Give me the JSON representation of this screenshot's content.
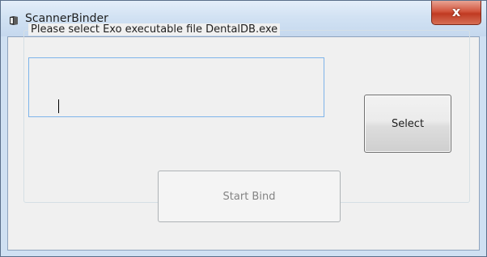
{
  "window": {
    "title": "ScannerBinder",
    "icon": "app-icon",
    "close_glyph": "x",
    "close_color": "#c7442b"
  },
  "group": {
    "label": "Please select Exo executable file DentalDB.exe"
  },
  "file_path": {
    "value": "",
    "placeholder": ""
  },
  "buttons": {
    "select_label": "Select",
    "start_label": "Start Bind",
    "start_enabled": false
  }
}
